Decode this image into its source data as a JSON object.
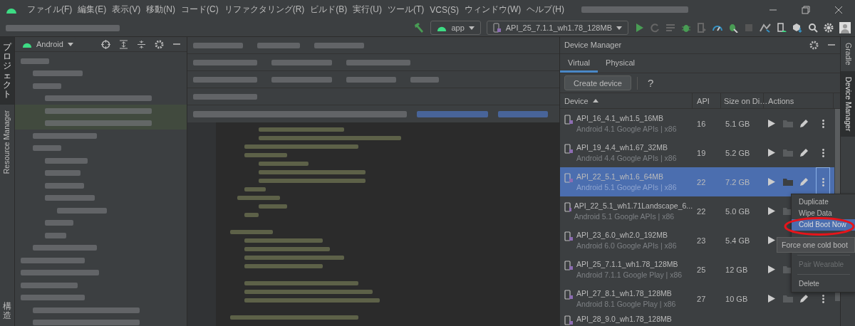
{
  "menu_bar": {
    "items": [
      "ファイル(F)",
      "編集(E)",
      "表示(V)",
      "移動(N)",
      "コード(C)",
      "リファクタリング(R)",
      "ビルド(B)",
      "実行(U)",
      "ツール(T)",
      "VCS(S)",
      "ウィンドウ(W)",
      "ヘルプ(H)"
    ]
  },
  "toolbar": {
    "run_config": "app",
    "device": "API_25_7.1.1_wh1.78_128MB"
  },
  "left_tool_strip": [
    {
      "label": "プロジェクト",
      "selected": true,
      "kind": "cjk"
    },
    {
      "label": "Resource Manager",
      "selected": false,
      "kind": "latin"
    },
    {
      "label": "構造",
      "selected": false,
      "kind": "cjk"
    }
  ],
  "project_panel": {
    "view": "Android"
  },
  "device_manager": {
    "title": "Device Manager",
    "tabs": [
      {
        "label": "Virtual",
        "selected": true
      },
      {
        "label": "Physical",
        "selected": false
      }
    ],
    "create_button": "Create device",
    "help": "?",
    "columns": [
      "Device",
      "API",
      "Size on Di…",
      "Actions"
    ],
    "rows": [
      {
        "name": "API_16_4.1_wh1.5_16MB",
        "subtitle": "Android 4.1 Google APIs | x86",
        "api": "16",
        "size": "5.1 GB",
        "selected": false
      },
      {
        "name": "API_19_4.4_wh1.67_32MB",
        "subtitle": "Android 4.4 Google APIs | x86",
        "api": "19",
        "size": "5.2 GB",
        "selected": false
      },
      {
        "name": "API_22_5.1_wh1.6_64MB",
        "subtitle": "Android 5.1 Google APIs | x86",
        "api": "22",
        "size": "7.2 GB",
        "selected": true
      },
      {
        "name": "API_22_5.1_wh1.71Landscape_6...",
        "subtitle": "Android 5.1 Google APIs | x86",
        "api": "22",
        "size": "5.0 GB",
        "selected": false
      },
      {
        "name": "API_23_6.0_wh2.0_192MB",
        "subtitle": "Android 6.0 Google APIs | x86",
        "api": "23",
        "size": "5.4 GB",
        "selected": false
      },
      {
        "name": "API_25_7.1.1_wh1.78_128MB",
        "subtitle": "Android 7.1.1 Google Play | x86",
        "api": "25",
        "size": "12 GB",
        "selected": false
      },
      {
        "name": "API_27_8.1_wh1.78_128MB",
        "subtitle": "Android 8.1 Google Play | x86",
        "api": "27",
        "size": "10 GB",
        "selected": false
      },
      {
        "name": "API_28_9.0_wh1.78_128MB",
        "selected": false
      }
    ]
  },
  "context_menu": {
    "items": [
      {
        "label": "Duplicate",
        "selected": false,
        "disabled": false,
        "separator_before": false
      },
      {
        "label": "Wipe Data",
        "selected": false,
        "disabled": false,
        "separator_before": false
      },
      {
        "label": "Cold Boot Now",
        "selected": true,
        "disabled": false,
        "separator_before": false
      },
      {
        "label": "Pair Wearable",
        "selected": false,
        "disabled": true,
        "separator_before": true
      },
      {
        "label": "Delete",
        "selected": false,
        "disabled": false,
        "separator_before": true
      }
    ]
  },
  "tooltip": "Force one cold boot",
  "right_tool_strip": [
    {
      "label": "Gradle",
      "selected": false
    },
    {
      "label": "Device Manager",
      "selected": true
    }
  ]
}
